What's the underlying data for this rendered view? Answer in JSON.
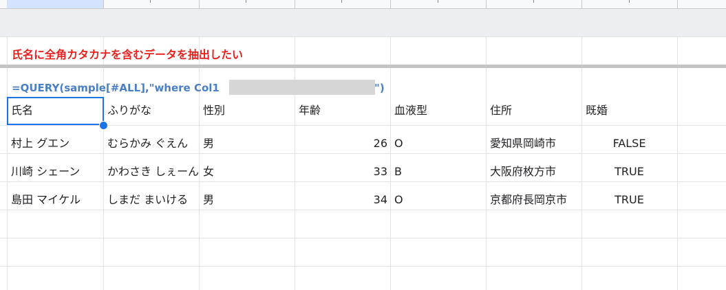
{
  "sheet": {
    "heading": "氏名に全角カタカナを含むデータを抽出したい",
    "formula_prefix": "=QUERY(sample[#ALL],\"where Col1",
    "formula_suffix": "\")",
    "headers": [
      "氏名",
      "ふりがな",
      "性別",
      "年齢",
      "血液型",
      "住所",
      "既婚"
    ],
    "rows": [
      {
        "name": "村上 グエン",
        "furigana": "むらかみ ぐえん",
        "gender": "男",
        "age": "26",
        "blood": "O",
        "address": "愛知県岡崎市",
        "married": "FALSE"
      },
      {
        "name": "川崎 シェーン",
        "furigana": "かわさき しぇーん",
        "gender": "女",
        "age": "33",
        "blood": "B",
        "address": "大阪府枚方市",
        "married": "TRUE"
      },
      {
        "name": "島田 マイケル",
        "furigana": "しまだ まいける",
        "gender": "男",
        "age": "34",
        "blood": "O",
        "address": "京都府長岡京市",
        "married": "TRUE"
      }
    ]
  },
  "colors": {
    "heading": "#e8201e",
    "formula": "#4a7fc1",
    "selection": "#1a73e8"
  }
}
